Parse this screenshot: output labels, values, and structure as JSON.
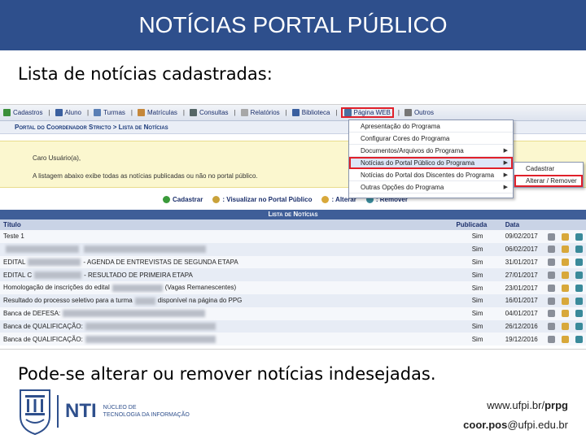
{
  "slide": {
    "title": "NOTÍCIAS PORTAL PÚBLICO",
    "intro": "Lista de notícias cadastradas:",
    "outro": "Pode-se alterar ou remover notícias indesejadas."
  },
  "menubar": {
    "items": [
      {
        "label": "Cadastros",
        "icon": "user-add-icon",
        "color": "#3a8f3a"
      },
      {
        "label": "Aluno",
        "icon": "student-icon",
        "color": "#3a5f9f"
      },
      {
        "label": "Turmas",
        "icon": "class-icon",
        "color": "#5a7fb5"
      },
      {
        "label": "Matrículas",
        "icon": "enrollment-icon",
        "color": "#c5873a"
      },
      {
        "label": "Consultas",
        "icon": "search-icon",
        "color": "#566"
      },
      {
        "label": "Relatórios",
        "icon": "report-icon",
        "color": "#a7a7a7"
      },
      {
        "label": "Biblioteca",
        "icon": "library-icon",
        "color": "#3a5f9f"
      },
      {
        "label": "Página WEB",
        "icon": "web-page-icon",
        "color": "#4a6f9f"
      },
      {
        "label": "Outros",
        "icon": "other-icon",
        "color": "#777"
      }
    ]
  },
  "breadcrumb": "Portal do Coordenador Stricto > Lista de Notícias",
  "notice": {
    "line1": "Caro Usuário(a),",
    "line2": "A listagem abaixo exibe todas as notícias publicadas ou não no portal público."
  },
  "actions": {
    "register": "Cadastrar",
    "view": ": Visualizar no Portal Público",
    "edit": ": Alterar",
    "remove": ": Remover"
  },
  "dropdown": {
    "items": [
      {
        "label": "Apresentação do Programa",
        "has_arrow": false
      },
      {
        "label": "Configurar Cores do Programa",
        "has_arrow": false
      },
      {
        "label": "Documentos/Arquivos do Programa",
        "has_arrow": true
      },
      {
        "label": "Notícias do Portal Público do Programa",
        "has_arrow": true
      },
      {
        "label": "Notícias do Portal dos Discentes do Programa",
        "has_arrow": true
      },
      {
        "label": "Outras Opções do Programa",
        "has_arrow": true
      }
    ],
    "submenu": [
      "Cadastrar",
      "Alterar / Remover"
    ]
  },
  "table": {
    "caption": "Lista de Notícias",
    "headers": {
      "title": "Título",
      "published": "Publicada",
      "date": "Data"
    },
    "rows": [
      {
        "prefix": "Teste 1",
        "blur1": 0,
        "middle": "",
        "blur2": 0,
        "suffix": "",
        "published": "Sim",
        "date": "09/02/2017"
      },
      {
        "prefix": "",
        "blur1": 90,
        "middle": "",
        "blur2": 150,
        "suffix": "",
        "published": "Sim",
        "date": "06/02/2017"
      },
      {
        "prefix": "EDITAL",
        "blur1": 65,
        "middle": "- AGENDA DE ENTREVISTAS DE SEGUNDA ETAPA",
        "blur2": 0,
        "suffix": "",
        "published": "Sim",
        "date": "31/01/2017"
      },
      {
        "prefix": "EDITAL C",
        "blur1": 58,
        "middle": "- RESULTADO DE PRIMEIRA ETAPA",
        "blur2": 0,
        "suffix": "",
        "published": "Sim",
        "date": "27/01/2017"
      },
      {
        "prefix": "Homologação de inscrições do edital",
        "blur1": 62,
        "middle": "(Vagas Remanescentes)",
        "blur2": 0,
        "suffix": "",
        "published": "Sim",
        "date": "23/01/2017"
      },
      {
        "prefix": "Resultado do processo seletivo para a turma",
        "blur1": 25,
        "middle": "disponível na página do PPG",
        "blur2": 0,
        "suffix": "",
        "published": "Sim",
        "date": "16/01/2017"
      },
      {
        "prefix": "Banca de DEFESA:",
        "blur1": 175,
        "middle": "",
        "blur2": 0,
        "suffix": "",
        "published": "Sim",
        "date": "04/01/2017"
      },
      {
        "prefix": "Banca de QUALIFICAÇÃO:",
        "blur1": 160,
        "middle": "",
        "blur2": 0,
        "suffix": "",
        "published": "Sim",
        "date": "26/12/2016"
      },
      {
        "prefix": "Banca de QUALIFICAÇÃO:",
        "blur1": 160,
        "middle": "",
        "blur2": 0,
        "suffix": "",
        "published": "Sim",
        "date": "19/12/2016"
      }
    ]
  },
  "footer": {
    "nti": "NTI",
    "nti_desc_line1": "NÚCLEO DE",
    "nti_desc_line2": "TECNOLOGIA DA INFORMAÇÃO",
    "site_prefix": "www.ufpi.br/",
    "site_bold": "prpg",
    "email_bold": "coor.pos",
    "email_suffix": "@ufpi.edu.br"
  },
  "colors": {
    "title_bar": "#2e4f8c",
    "highlight": "#e0202a",
    "published_green": "#2a8a2a"
  }
}
